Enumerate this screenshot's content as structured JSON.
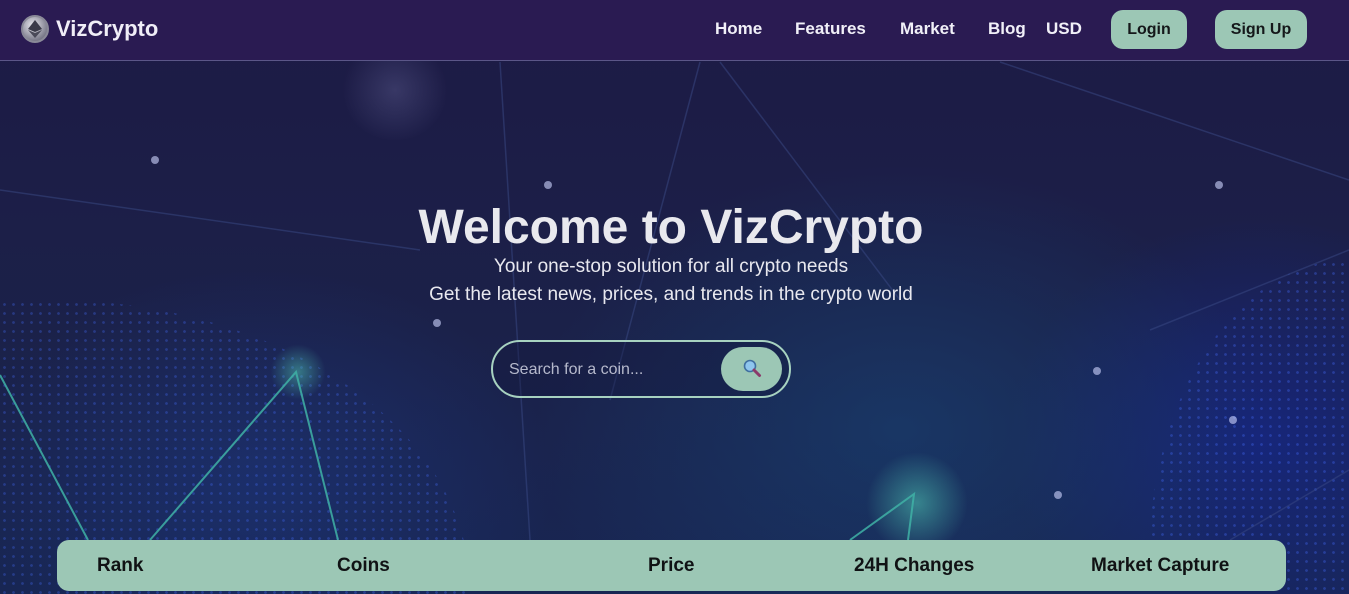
{
  "brand": {
    "name": "VizCrypto",
    "logo_icon": "ethereum-coin-icon"
  },
  "nav": {
    "links": [
      "Home",
      "Features",
      "Market",
      "Blog"
    ],
    "currency": "USD",
    "login_label": "Login",
    "signup_label": "Sign Up"
  },
  "hero": {
    "title": "Welcome to VizCrypto",
    "subtitle_1": "Your one-stop solution for all crypto needs",
    "subtitle_2": "Get the latest news, prices, and trends in the crypto world"
  },
  "search": {
    "placeholder": "Search for a coin...",
    "value": "",
    "button_icon": "magnifier-icon"
  },
  "table": {
    "headers": [
      "Rank",
      "Coins",
      "Price",
      "24H Changes",
      "Market Capture"
    ]
  },
  "colors": {
    "nav_bg": "#2a1b52",
    "accent": "#9cc7b5",
    "hero_bg": "#1b2149"
  }
}
